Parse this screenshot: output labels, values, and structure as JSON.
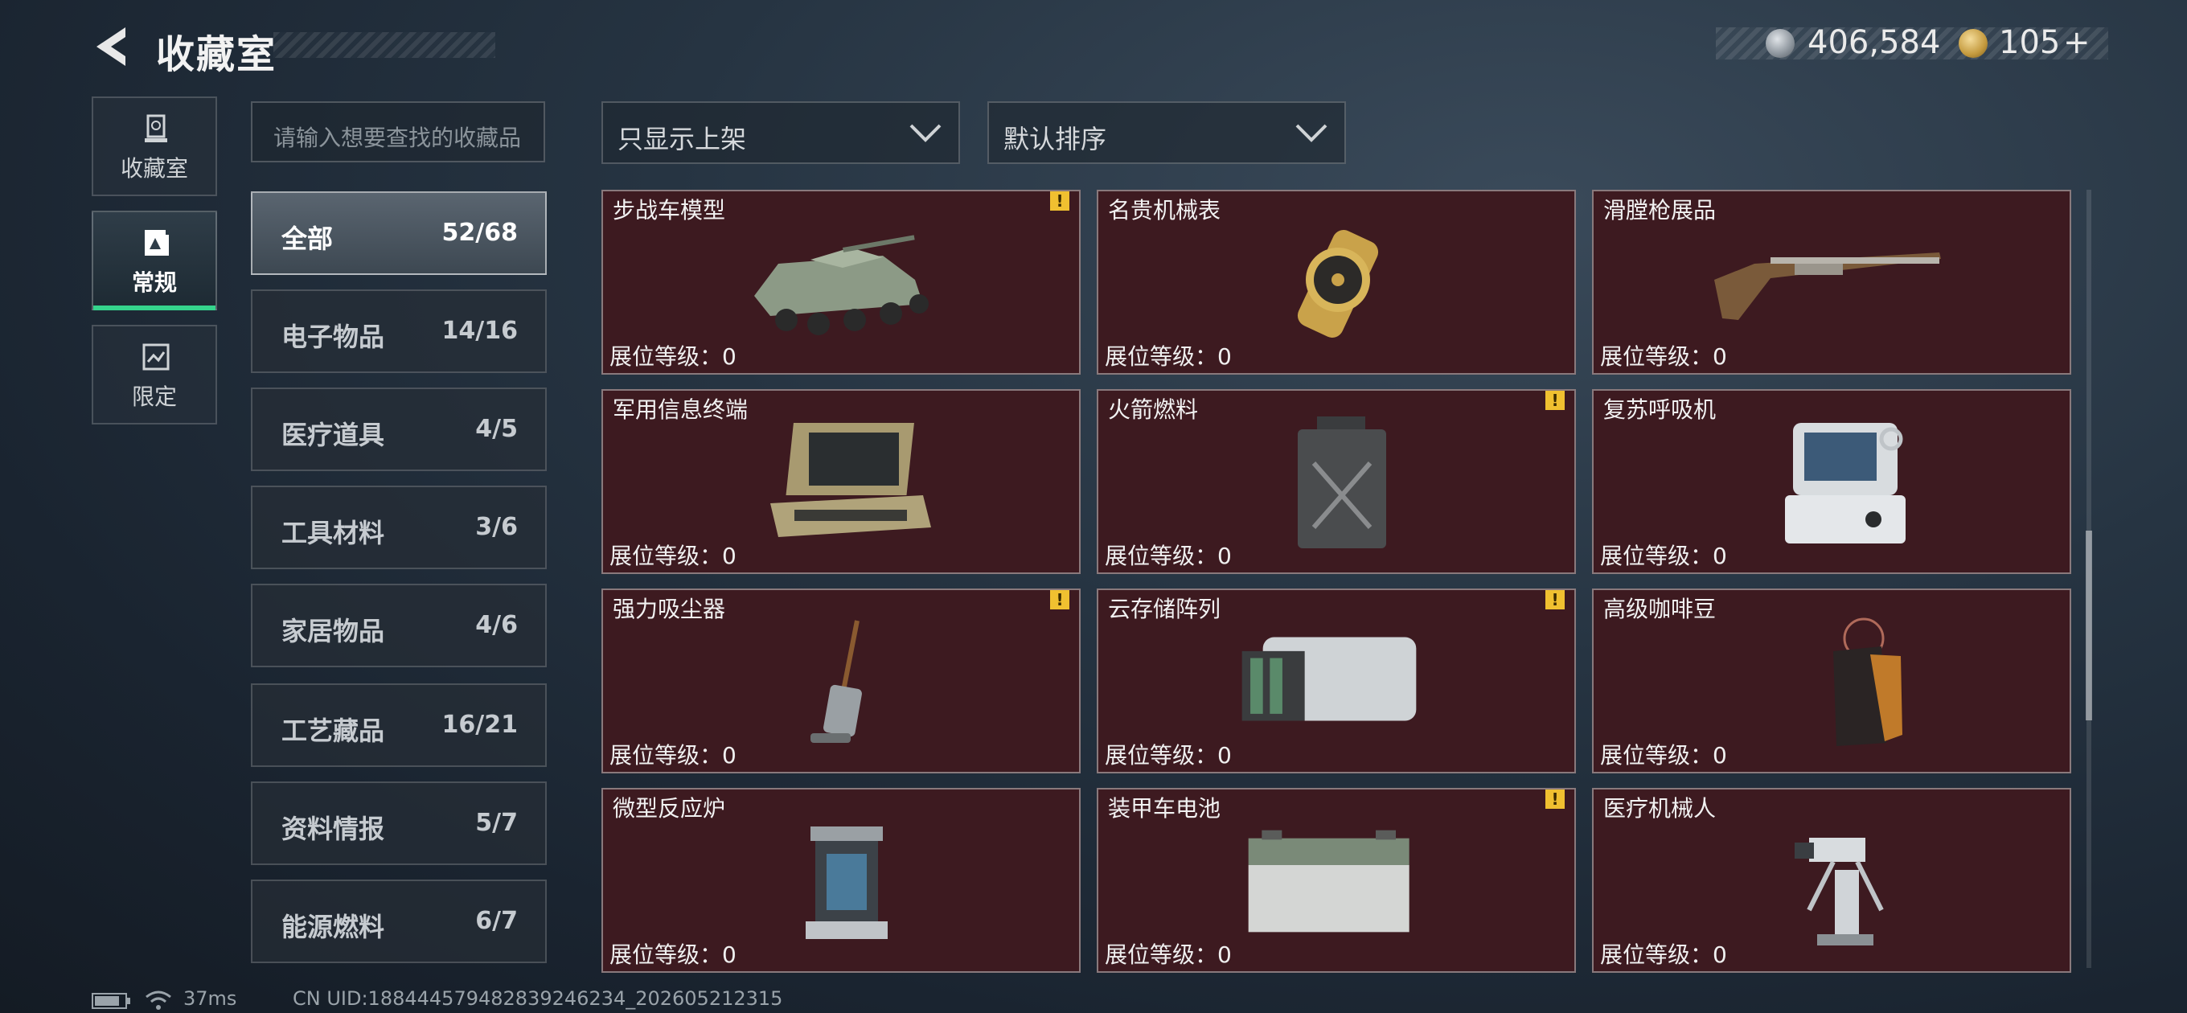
{
  "header": {
    "title": "收藏室"
  },
  "currency": {
    "silver": "406,584",
    "gold": "105",
    "gold_add": "+"
  },
  "side_tabs": [
    {
      "label": "收藏室",
      "icon": "trophy-icon"
    },
    {
      "label": "常规",
      "icon": "gallery-icon",
      "active": true
    },
    {
      "label": "限定",
      "icon": "limited-icon"
    }
  ],
  "search": {
    "placeholder": "请输入想要查找的收藏品"
  },
  "categories": [
    {
      "name": "全部",
      "count": "52/68",
      "active": true
    },
    {
      "name": "电子物品",
      "count": "14/16"
    },
    {
      "name": "医疗道具",
      "count": "4/5"
    },
    {
      "name": "工具材料",
      "count": "3/6"
    },
    {
      "name": "家居物品",
      "count": "4/6"
    },
    {
      "name": "工艺藏品",
      "count": "16/21"
    },
    {
      "name": "资料情报",
      "count": "5/7"
    },
    {
      "name": "能源燃料",
      "count": "6/7"
    }
  ],
  "filters": {
    "shelf_filter": "只显示上架",
    "sort": "默认排序"
  },
  "level_label": "展位等级：0",
  "items": [
    {
      "name": "步战车模型",
      "warn": true,
      "icon": "ifv-model-icon"
    },
    {
      "name": "名贵机械表",
      "warn": false,
      "icon": "watch-icon"
    },
    {
      "name": "滑膛枪展品",
      "warn": false,
      "icon": "musket-icon"
    },
    {
      "name": "军用信息终端",
      "warn": false,
      "icon": "terminal-icon"
    },
    {
      "name": "火箭燃料",
      "warn": true,
      "icon": "fuel-can-icon"
    },
    {
      "name": "复苏呼吸机",
      "warn": false,
      "icon": "ventilator-icon"
    },
    {
      "name": "强力吸尘器",
      "warn": true,
      "icon": "vacuum-icon"
    },
    {
      "name": "云存储阵列",
      "warn": true,
      "icon": "storage-array-icon"
    },
    {
      "name": "高级咖啡豆",
      "warn": false,
      "icon": "coffee-bag-icon"
    },
    {
      "name": "微型反应炉",
      "warn": false,
      "icon": "reactor-icon"
    },
    {
      "name": "装甲车电池",
      "warn": true,
      "icon": "battery-icon"
    },
    {
      "name": "医疗机械人",
      "warn": false,
      "icon": "med-robot-icon"
    }
  ],
  "status_bar": {
    "ping": "37ms",
    "uid": "CN UID:18844457948283924623​4_202605212315"
  }
}
